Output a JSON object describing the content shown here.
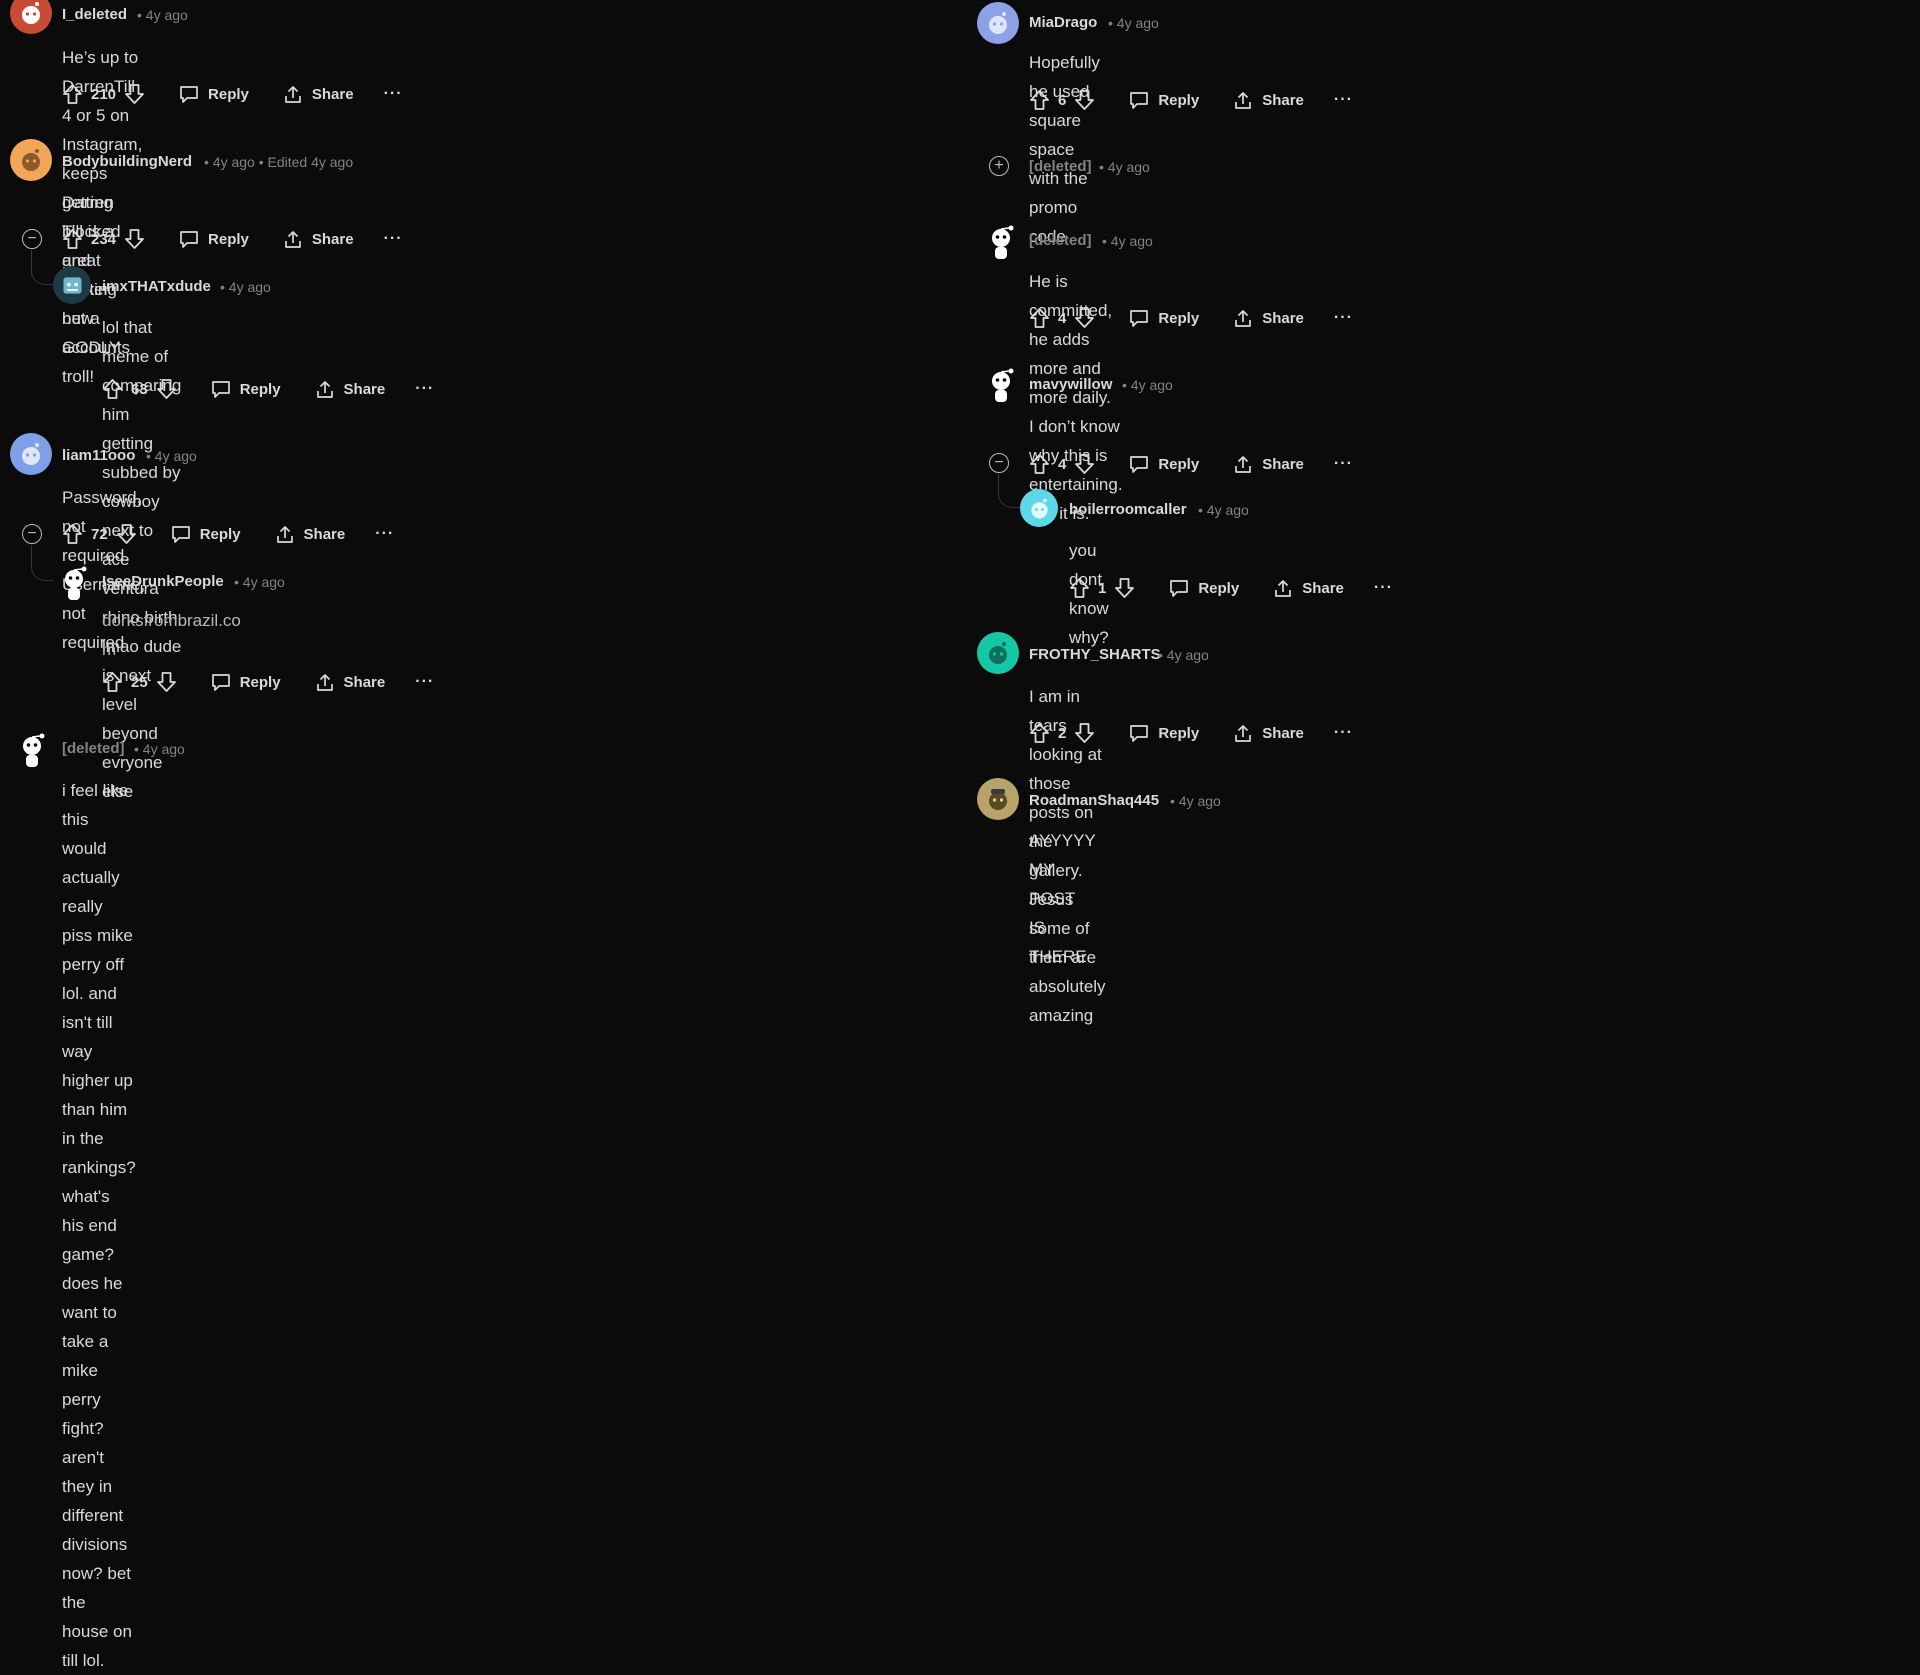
{
  "colors": {
    "background": "#0b0b0b",
    "text": "#d7dadc",
    "muted": "#818384",
    "thread": "#343536"
  },
  "action_labels": {
    "reply": "Reply",
    "share": "Share",
    "more": "···"
  },
  "icons": {
    "upvote": "upvote-arrow-icon",
    "downvote": "downvote-arrow-icon",
    "reply": "speech-bubble-icon",
    "share": "share-upload-icon",
    "collapse": "minus-circle-icon",
    "expand": "plus-circle-icon",
    "avatar": "reddit-snoo-avatar"
  },
  "left": [
    {
      "author": "I_deleted",
      "meta": "• 4y ago",
      "body": "He’s up to DarrenTill 4 or 5 on Instagram, keeps getting blocked and making new accounts",
      "votes": "210",
      "avatar_color": "#c64c36"
    },
    {
      "author": "BodybuildingNerd",
      "meta": "• 4y ago • Edited 4y ago",
      "body": "Darren Till is a great fighter but a GODLY troll!",
      "votes": "234",
      "avatar_color": "#f2a65a"
    },
    {
      "author": "imxTHATxdude",
      "meta": "• 4y ago",
      "body_lines": [
        "lol that meme of comparing him getting subbed by cowboy next to ace ventura rhino birth lmao dude is next",
        "level beyond evryone else"
      ],
      "votes": "63",
      "avatar_color": "#6fb7c9"
    },
    {
      "author": "liam11ooo",
      "meta": "• 4y ago",
      "body": "Password, not required. Username, not required",
      "votes": "72",
      "avatar_color": "#7f9fe8"
    },
    {
      "author": "IseeDrunkPeople",
      "meta": "• 4y ago",
      "body_lines": [
        "dorksfrombrazil.co",
        "m"
      ],
      "votes": "25",
      "avatar_color": "transparent"
    },
    {
      "author": "[deleted]",
      "meta": "• 4y ago",
      "body_lines": [
        "i feel like this would actually really piss mike perry off lol. and isn't till way higher up than him in the rankings?",
        "what's his end game? does he want to take a mike perry fight? aren't they in different divisions now? bet the",
        "house on till lol."
      ],
      "avatar_color": "transparent"
    }
  ],
  "right": [
    {
      "author": "MiaDrago",
      "meta": "• 4y ago",
      "body": "Hopefully he used square space with the promo code",
      "votes": "6",
      "avatar_color": "#8ca1e8"
    },
    {
      "author": "[deleted]",
      "meta": "• 4y ago"
    },
    {
      "author": "[deleted]",
      "meta": "• 4y ago",
      "body": "He is committed, he adds more and more daily.",
      "votes": "4",
      "avatar_color": "transparent"
    },
    {
      "author": "mavywillow",
      "meta": "• 4y ago",
      "body": "I don’t know why this is entertaining. But it is.",
      "votes": "4",
      "avatar_color": "transparent"
    },
    {
      "author": "boilerroomcaller",
      "meta": "• 4y ago",
      "body": "you dont know why?",
      "votes": "1",
      "avatar_color": "#5cd8e8"
    },
    {
      "author": "FROTHY_SHARTS",
      "meta": "• 4y ago",
      "body": "I am in tears looking at those posts on the gallery. Jesus some of them are absolutely amazing",
      "votes": "2",
      "avatar_color": "#16c7a6"
    },
    {
      "author": "RoadmanShaq445",
      "meta": "• 4y ago",
      "body": "AYYYYY MY POST IS THERE",
      "avatar_color": "#b8a36a"
    }
  ]
}
